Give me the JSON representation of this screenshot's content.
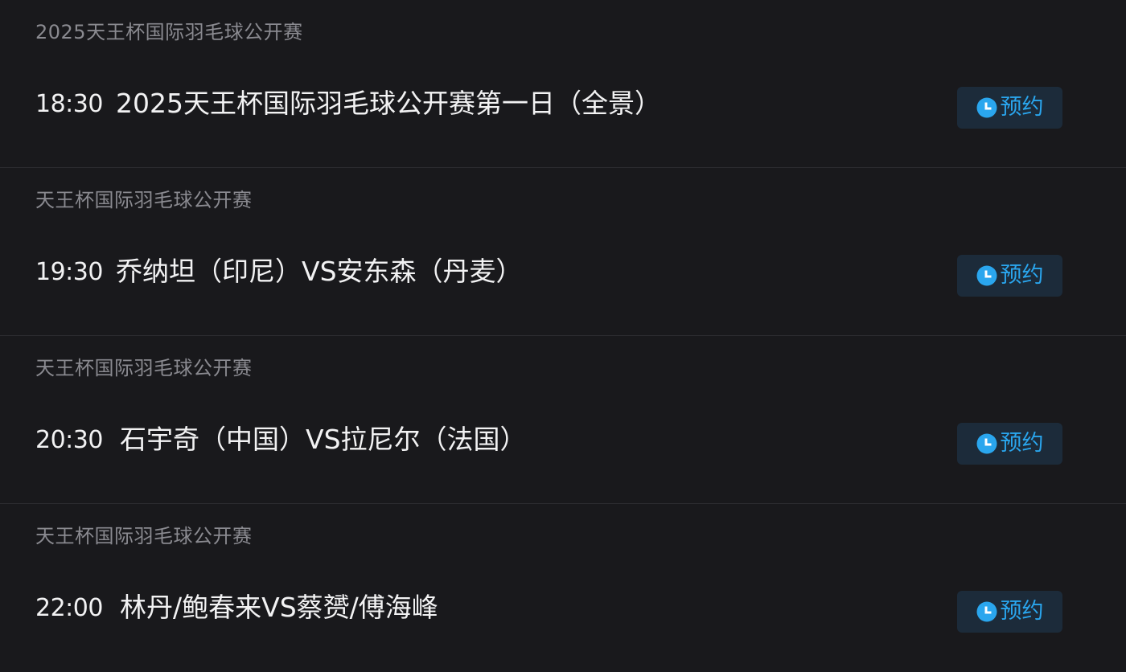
{
  "colors": {
    "background": "#19191c",
    "divider": "#2c2c31",
    "category_text": "#8a8a90",
    "primary_text": "#f2f2f3",
    "button_bg": "#1c2b3a",
    "accent": "#2aa6ee"
  },
  "schedule": [
    {
      "category": "2025天王杯国际羽毛球公开赛",
      "time": "18:30",
      "title": "2025天王杯国际羽毛球公开赛第一日（全景）",
      "button_icon": "clock-icon",
      "button_label": "预约"
    },
    {
      "category": "天王杯国际羽毛球公开赛",
      "time": "19:30",
      "title": "乔纳坦（印尼）VS安东森（丹麦）",
      "button_icon": "clock-icon",
      "button_label": "预约"
    },
    {
      "category": "天王杯国际羽毛球公开赛",
      "time": "20:30",
      "title": "石宇奇（中国）VS拉尼尔（法国）",
      "button_icon": "clock-icon",
      "button_label": "预约"
    },
    {
      "category": "天王杯国际羽毛球公开赛",
      "time": "22:00",
      "title": "林丹/鲍春来VS蔡赟/傅海峰",
      "button_icon": "clock-icon",
      "button_label": "预约"
    }
  ]
}
